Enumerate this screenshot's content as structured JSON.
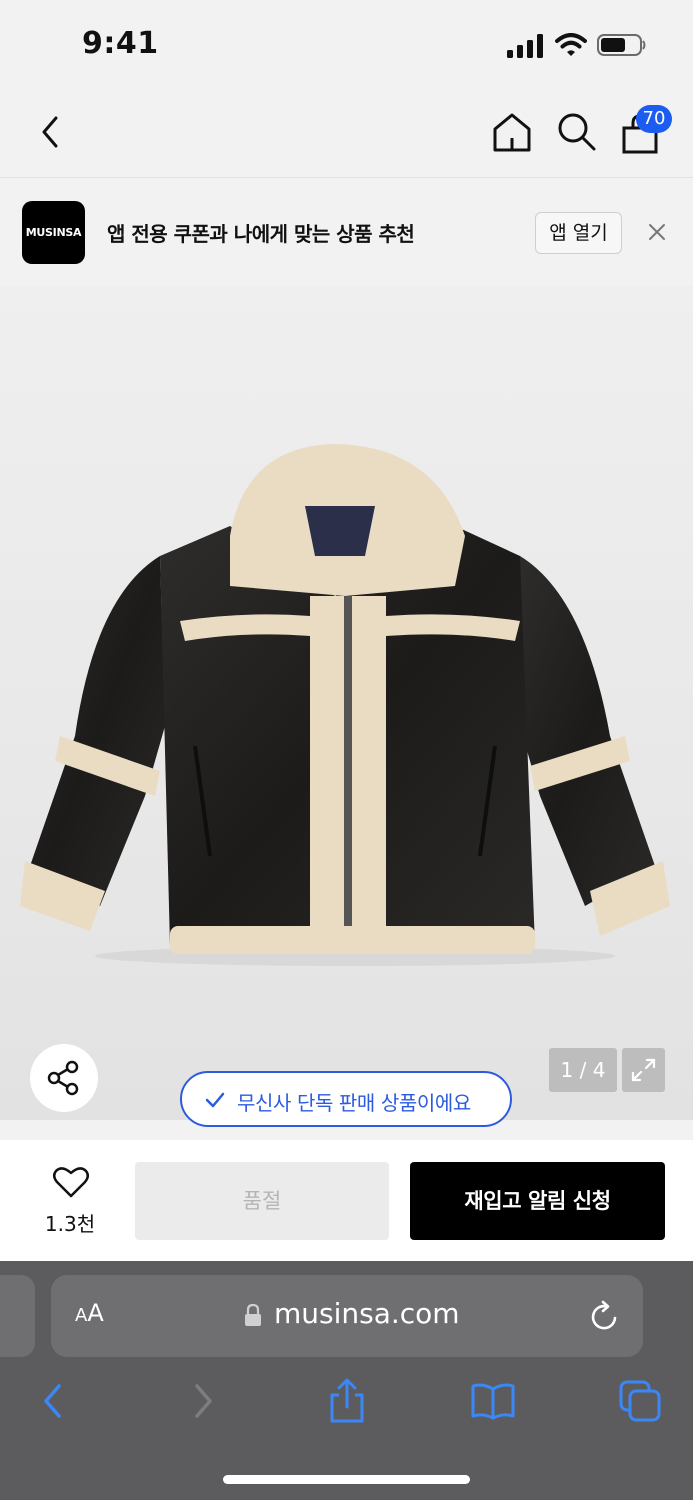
{
  "status_bar": {
    "time": "9:41"
  },
  "nav": {
    "cart_count": "70"
  },
  "app_banner": {
    "logo_text": "MUSINSA",
    "message": "앱 전용 쿠폰과 나에게 맞는 상품 추천",
    "open_app_label": "앱 열기"
  },
  "gallery": {
    "counter": "1 / 4",
    "exclusive_label": "무신사 단독 판매 상품이에요"
  },
  "purchase": {
    "like_count": "1.3천",
    "soldout_label": "품절",
    "restock_label": "재입고 알림 신청"
  },
  "browser": {
    "aa_label_big": "A",
    "aa_label_small": "A",
    "url": "musinsa.com"
  },
  "colors": {
    "accent_blue": "#2c5be0",
    "badge_blue": "#1d5cf1",
    "primary_button": "#000000"
  }
}
